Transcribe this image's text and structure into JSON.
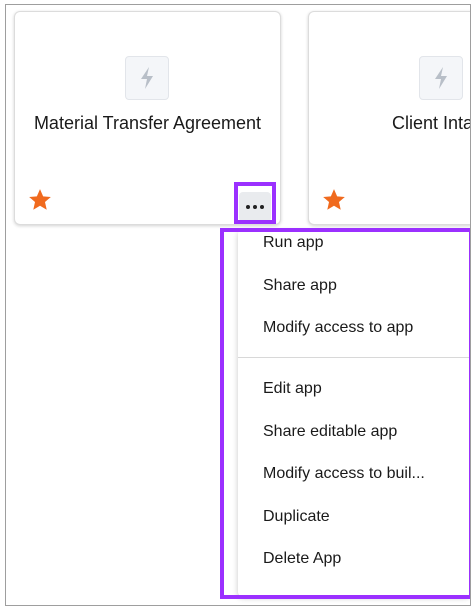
{
  "cards": [
    {
      "title": "Material Transfer Agreement",
      "favorite": true
    },
    {
      "title": "Client Inta",
      "favorite": true
    }
  ],
  "more_button": {
    "icon": "ellipsis-icon"
  },
  "menu": {
    "group1": [
      "Run app",
      "Share app",
      "Modify access to app"
    ],
    "group2": [
      "Edit app",
      "Share editable app",
      "Modify access to buil...",
      "Duplicate",
      "Delete App"
    ]
  },
  "colors": {
    "star": "#f06a1e",
    "highlight": "#9b30ff",
    "app_icon": "#b8bfc8"
  }
}
